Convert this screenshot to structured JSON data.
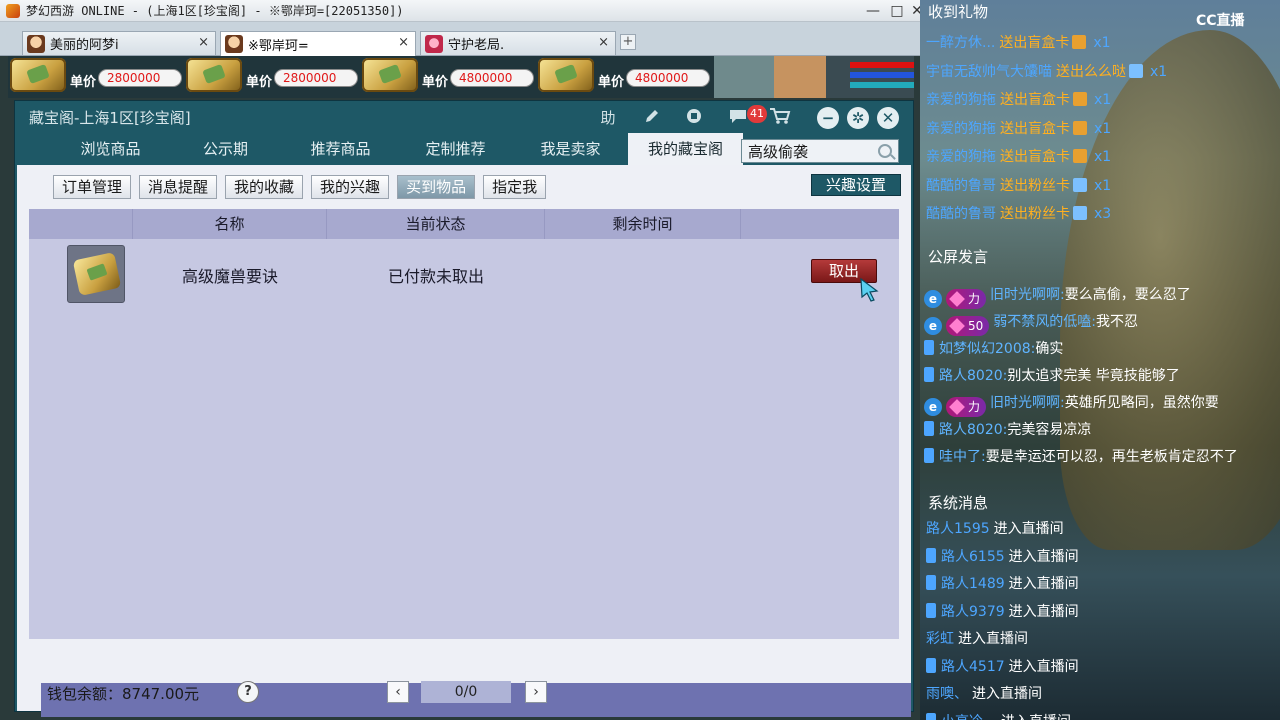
{
  "window": {
    "title": "梦幻西游 ONLINE - (上海1区[珍宝阁] - ※鄂岸珂=[22051350])",
    "minimize": "—",
    "maximize": "□",
    "close": "✕"
  },
  "game_tabs": [
    {
      "label": "美丽的阿梦i",
      "close": "×"
    },
    {
      "label": "※鄂岸珂=",
      "close": "×"
    },
    {
      "label": "守护老局.",
      "close": "×"
    }
  ],
  "tab_add": "+",
  "shop_strip": {
    "price_label": "单价",
    "prices": [
      "2800000",
      "2800000",
      "4800000",
      "4800000"
    ]
  },
  "dialog": {
    "title": "藏宝阁-上海1区[珍宝阁]",
    "tools": {
      "help": "助",
      "message_count": "41"
    },
    "buttons": {
      "minimize": "−",
      "settings": "✲",
      "close": "✕"
    },
    "nav_tabs": [
      "浏览商品",
      "公示期",
      "推荐商品",
      "定制推荐",
      "我是卖家",
      "我的藏宝阁"
    ],
    "search": {
      "value": "高级偷袭"
    },
    "sub_tabs": [
      "订单管理",
      "消息提醒",
      "我的收藏",
      "我的兴趣",
      "买到物品",
      "指定我"
    ],
    "interest_settings": "兴趣设置",
    "table": {
      "columns": [
        "",
        "名称",
        "当前状态",
        "剩余时间",
        ""
      ],
      "rows": [
        {
          "name": "高级魔兽要诀",
          "status": "已付款未取出",
          "time_left": "",
          "action": "取出"
        }
      ]
    },
    "wallet": "钱包余额：8747.00元",
    "help": "?",
    "pagination": {
      "prev": "‹",
      "info": "0/0",
      "next": "›"
    }
  },
  "stream": {
    "logo": "CC直播",
    "gift_title": "收到礼物",
    "gifts": [
      {
        "user": "一醉方休...",
        "action": "送出盲盒卡",
        "count": "x1",
        "icon": "gift-box-icon"
      },
      {
        "user": "宇宙无敌帅气大馕喵",
        "action": "送出么么哒",
        "count": "x1",
        "icon": "kiss-icon"
      },
      {
        "user": "亲爱的狗拖",
        "action": "送出盲盒卡",
        "count": "x1",
        "icon": "gift-box-icon"
      },
      {
        "user": "亲爱的狗拖",
        "action": "送出盲盒卡",
        "count": "x1",
        "icon": "gift-box-icon"
      },
      {
        "user": "亲爱的狗拖",
        "action": "送出盲盒卡",
        "count": "x1",
        "icon": "gift-box-icon"
      },
      {
        "user": "酷酷的鲁哥",
        "action": "送出粉丝卡",
        "count": "x1",
        "icon": "fan-card-icon"
      },
      {
        "user": "酷酷的鲁哥",
        "action": "送出粉丝卡",
        "count": "x3",
        "icon": "fan-card-icon"
      }
    ],
    "chat_title": "公屏发言",
    "chat": [
      {
        "badge": "力",
        "user": "旧时光啊啊:",
        "text": "要么高偷，要么忍了"
      },
      {
        "badge": "50",
        "user": "弱不禁风的低嗑:",
        "text": "我不忍"
      },
      {
        "badge": "",
        "user": "如梦似幻2008:",
        "text": "确实"
      },
      {
        "badge": "",
        "user": "路人8020:",
        "text": "别太追求完美 毕竟技能够了"
      },
      {
        "badge": "力",
        "user": "旧时光啊啊:",
        "text": "英雄所见略同，虽然你要"
      },
      {
        "badge": "",
        "user": "路人8020:",
        "text": "完美容易凉凉"
      },
      {
        "badge": "",
        "user": "哇中了:",
        "text": "要是幸运还可以忍，再生老板肯定忍不了"
      }
    ],
    "sys_title": "系统消息",
    "system": [
      {
        "user": "路人1595",
        "text": "进入直播间"
      },
      {
        "user": "路人6155",
        "text": "进入直播间"
      },
      {
        "user": "路人1489",
        "text": "进入直播间"
      },
      {
        "user": "路人9379",
        "text": "进入直播间"
      },
      {
        "user": "彩虹",
        "text": "进入直播间"
      },
      {
        "user": "路人4517",
        "text": "进入直播间"
      },
      {
        "user": "雨噢、",
        "text": "进入直播间"
      },
      {
        "user": "小高冷、",
        "text": "进入直播间"
      }
    ]
  }
}
